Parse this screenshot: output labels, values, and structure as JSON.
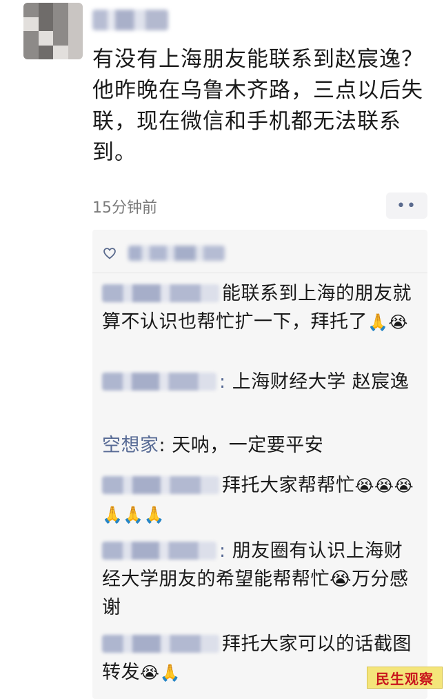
{
  "post": {
    "text": "有没有上海朋友能联系到赵宸逸？他昨晚在乌鲁木齐路，三点以后失联，现在微信和手机都无法联系到。",
    "time": "15分钟前",
    "more_label": "••"
  },
  "comments": [
    {
      "name_visible": "",
      "sep": "",
      "text": "能联系到上海的朋友就算不认识也帮忙扩一下，拜托了",
      "emoji": "🙏😭"
    },
    {
      "name_visible": "",
      "sep": ":",
      "text": " 上海财经大学 赵宸逸",
      "emoji": ""
    },
    {
      "name_visible": "空想家",
      "sep": ":",
      "text": " 天呐，一定要平安",
      "emoji": ""
    },
    {
      "name_visible": "",
      "sep": "",
      "text": "拜托大家帮帮忙",
      "emoji": "😭😭😭🙏🙏🙏"
    },
    {
      "name_visible": "",
      "sep": ":",
      "text": " 朋友圈有认识上海财经大学朋友的希望能帮帮忙😭万分感谢",
      "emoji": ""
    },
    {
      "name_visible": "",
      "sep": "",
      "text": "拜托大家可以的话截图转发",
      "emoji": "😭🙏"
    }
  ],
  "watermark": "民生观察",
  "colors": {
    "name_link": "#586b95",
    "watermark_bg": "#f4e57a",
    "watermark_text": "#c8161d"
  },
  "icons": {
    "like": "heart-outline-icon",
    "more": "more-dots-icon"
  }
}
